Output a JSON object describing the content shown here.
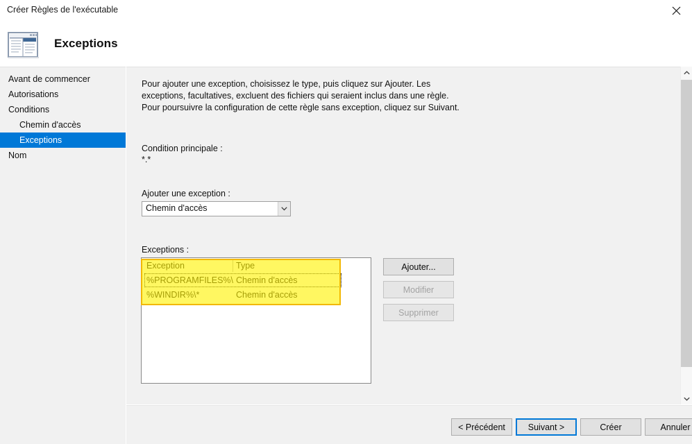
{
  "window": {
    "title": "Créer Règles de l'exécutable",
    "close_icon": "close-icon"
  },
  "header": {
    "icon": "wizard-page-icon",
    "title": "Exceptions"
  },
  "sidebar": {
    "items": [
      {
        "label": "Avant de commencer",
        "indent": false,
        "selected": false
      },
      {
        "label": "Autorisations",
        "indent": false,
        "selected": false
      },
      {
        "label": "Conditions",
        "indent": false,
        "selected": false
      },
      {
        "label": "Chemin d'accès",
        "indent": true,
        "selected": false
      },
      {
        "label": "Exceptions",
        "indent": true,
        "selected": true
      },
      {
        "label": "Nom",
        "indent": false,
        "selected": false
      }
    ]
  },
  "main": {
    "description": "Pour ajouter une exception, choisissez le type, puis cliquez sur Ajouter.  Les exceptions, facultatives, excluent des fichiers qui seraient inclus dans une règle. Pour poursuivre la configuration de cette règle sans exception, cliquez sur Suivant.",
    "primary_condition_label": "Condition principale :",
    "primary_condition_value": "*.*",
    "add_exception_label": "Ajouter une exception :",
    "exception_type_select": {
      "value": "Chemin d'accès",
      "arrow_icon": "chevron-down-icon"
    },
    "exceptions_label": "Exceptions :",
    "table": {
      "columns": [
        "Exception",
        "Type"
      ],
      "rows": [
        {
          "exception": "%PROGRAMFILES%\\*",
          "type": "Chemin d'accès",
          "focused": true
        },
        {
          "exception": "%WINDIR%\\*",
          "type": "Chemin d'accès",
          "focused": false
        }
      ]
    },
    "side_buttons": [
      {
        "label": "Ajouter...",
        "enabled": true
      },
      {
        "label": "Modifier",
        "enabled": false
      },
      {
        "label": "Supprimer",
        "enabled": false
      }
    ]
  },
  "scrollbar": {
    "up_icon": "chevron-up-icon",
    "down_icon": "chevron-down-icon"
  },
  "footer": {
    "buttons": [
      {
        "label": "< Précédent",
        "focused": false
      },
      {
        "label": "Suivant >",
        "focused": true
      },
      {
        "label": "Créer",
        "focused": false
      },
      {
        "label": "Annuler",
        "focused": false
      }
    ]
  },
  "colors": {
    "selection_blue": "#0078d7",
    "panel_grey": "#f1f1f1",
    "highlight_yellow": "#fff200",
    "highlight_border": "#f2b800"
  }
}
